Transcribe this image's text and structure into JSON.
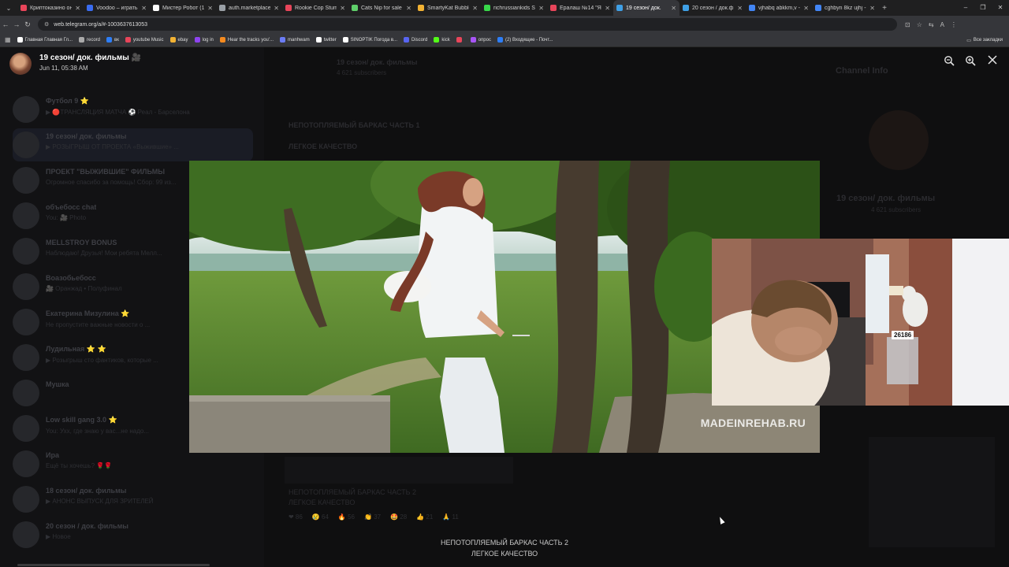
{
  "browser": {
    "tabs": [
      {
        "title": "Криптоказино онл",
        "color": "#e8455a"
      },
      {
        "title": "Voodoo – играть в",
        "color": "#3a6cf0"
      },
      {
        "title": "Мистер Робот (1-4",
        "color": "#ffffff"
      },
      {
        "title": "auth.marketplace.u",
        "color": "#9aa0a6"
      },
      {
        "title": "Rookie Cop Stumbl",
        "color": "#e8455a"
      },
      {
        "title": "Cats Nip for sale |",
        "color": "#5fcf6a"
      },
      {
        "title": "SmartyKat Bubble F",
        "color": "#f2b233"
      },
      {
        "title": "richrussiankids Stre",
        "color": "#38d84a"
      },
      {
        "title": "Ералаш №14 \"Я с",
        "color": "#e8455a"
      },
      {
        "title": "19 сезон/ док.",
        "color": "#3fa0e6",
        "active": true
      },
      {
        "title": "20 сезон / док.фил",
        "color": "#3fa0e6"
      },
      {
        "title": "vjhabq abkkm,v - G",
        "color": "#4285f4"
      },
      {
        "title": "cghbyn 8kz ujhj - G",
        "color": "#4285f4"
      }
    ],
    "url": "web.telegram.org/a/#-1003637613053",
    "bookmarks": [
      {
        "label": "Главная Главная Гл...",
        "color": "#ffffff"
      },
      {
        "label": "record",
        "color": "#aaaaaa"
      },
      {
        "label": "вк",
        "color": "#2d7ef7"
      },
      {
        "label": "youtube Music",
        "color": "#e8455a"
      },
      {
        "label": "ebay",
        "color": "#f2b233"
      },
      {
        "label": "log in",
        "color": "#8e44ef"
      },
      {
        "label": "Hear the tracks you'...",
        "color": "#f58a1f"
      },
      {
        "label": "manhwam",
        "color": "#6b7cf5"
      },
      {
        "label": "twitter",
        "color": "#ffffff"
      },
      {
        "label": "SINOPTIK Погода в...",
        "color": "#ffffff"
      },
      {
        "label": "Discord",
        "color": "#5865f2"
      },
      {
        "label": "kick",
        "color": "#53fc18"
      },
      {
        "label": "",
        "color": "#e8455a"
      },
      {
        "label": "опрос",
        "color": "#a855f7"
      },
      {
        "label": "(2) Входящие - Почт...",
        "color": "#2d7ef7"
      }
    ],
    "bookmarks_right": "Все закладки"
  },
  "viewer": {
    "title": "19 сезон/ док. фильмы 🎥",
    "date": "Jun 11, 05:38 AM",
    "watermark": "MADEINREHAB.RU",
    "pip_badge": "26186",
    "caption_line1": "НЕПОТОПЛЯЕМЫЙ БАРКАС ЧАСТЬ 2",
    "caption_line2": "ЛЕГКОЕ КАЧЕСТВО"
  },
  "background": {
    "chats": [
      {
        "name": "Футбол 9 ⭐",
        "preview": "▶ 🔴ТРАНСЛЯЦИЯ МАТЧА ⚽ Реал - Барселона"
      },
      {
        "name": "19 сезон/ док. фильмы",
        "preview": "▶ РОЗЫГРЫШ ОТ ПРОЕКТА «Выжившие» ...",
        "active": true
      },
      {
        "name": "ПРОЕКТ \"ВЫЖИВШИЕ\" ФИЛЬМЫ",
        "preview": "Огромное спасибо за помощь! Сбор: 99 из..."
      },
      {
        "name": "объебосс chat",
        "preview": "You: 🎥 Photo"
      },
      {
        "name": "MELLSTROY BONUS",
        "preview": "Наблюдаю! Друзья! Мои ребята Мелл..."
      },
      {
        "name": "Воазобьебосс",
        "preview": "🎥 Оранжад • Полуфинал"
      },
      {
        "name": "Екатерина Мизулина ⭐",
        "preview": "Не пропустите важные новости о ..."
      },
      {
        "name": "Лудильная ⭐ ⭐",
        "preview": "▶ Розыгрыш сто фантиков, которые ..."
      },
      {
        "name": "Мушка",
        "preview": ""
      },
      {
        "name": "Low skill gang 3.0 ⭐",
        "preview": "You: Ухх, где знаю у вас...не надо..."
      },
      {
        "name": "Ира",
        "preview": "Ещё ты хочешь? 🌹🌹"
      },
      {
        "name": "18 сезон/ док. фильмы",
        "preview": "▶ АНОНС ВЫПУСК ДЛЯ ЗРИТЕЛЕЙ"
      },
      {
        "name": "20 сезон / док. фильмы",
        "preview": "▶ Новое"
      }
    ],
    "header_title": "19 сезон/ док. фильмы",
    "header_sub": "4 621 subscribers",
    "post1_title": "НЕПОТОПЛЯЕМЫЙ БАРКАС ЧАСТЬ 1",
    "post1_sub": "ЛЕГКОЕ КАЧЕСТВО",
    "post2_title": "НЕПОТОПЛЯЕМЫЙ БАРКАС ЧАСТЬ 2",
    "post2_sub": "ЛЕГКОЕ КАЧЕСТВО",
    "reactions": [
      "❤ 86",
      "😢 64",
      "🔥 56",
      "👏 37",
      "🤩 28",
      "👍 21",
      "🙏 11"
    ],
    "right_panel_title": "Channel Info",
    "right_panel_name": "19 сезон/ док. фильмы",
    "right_panel_sub": "4 621 subscribers"
  }
}
